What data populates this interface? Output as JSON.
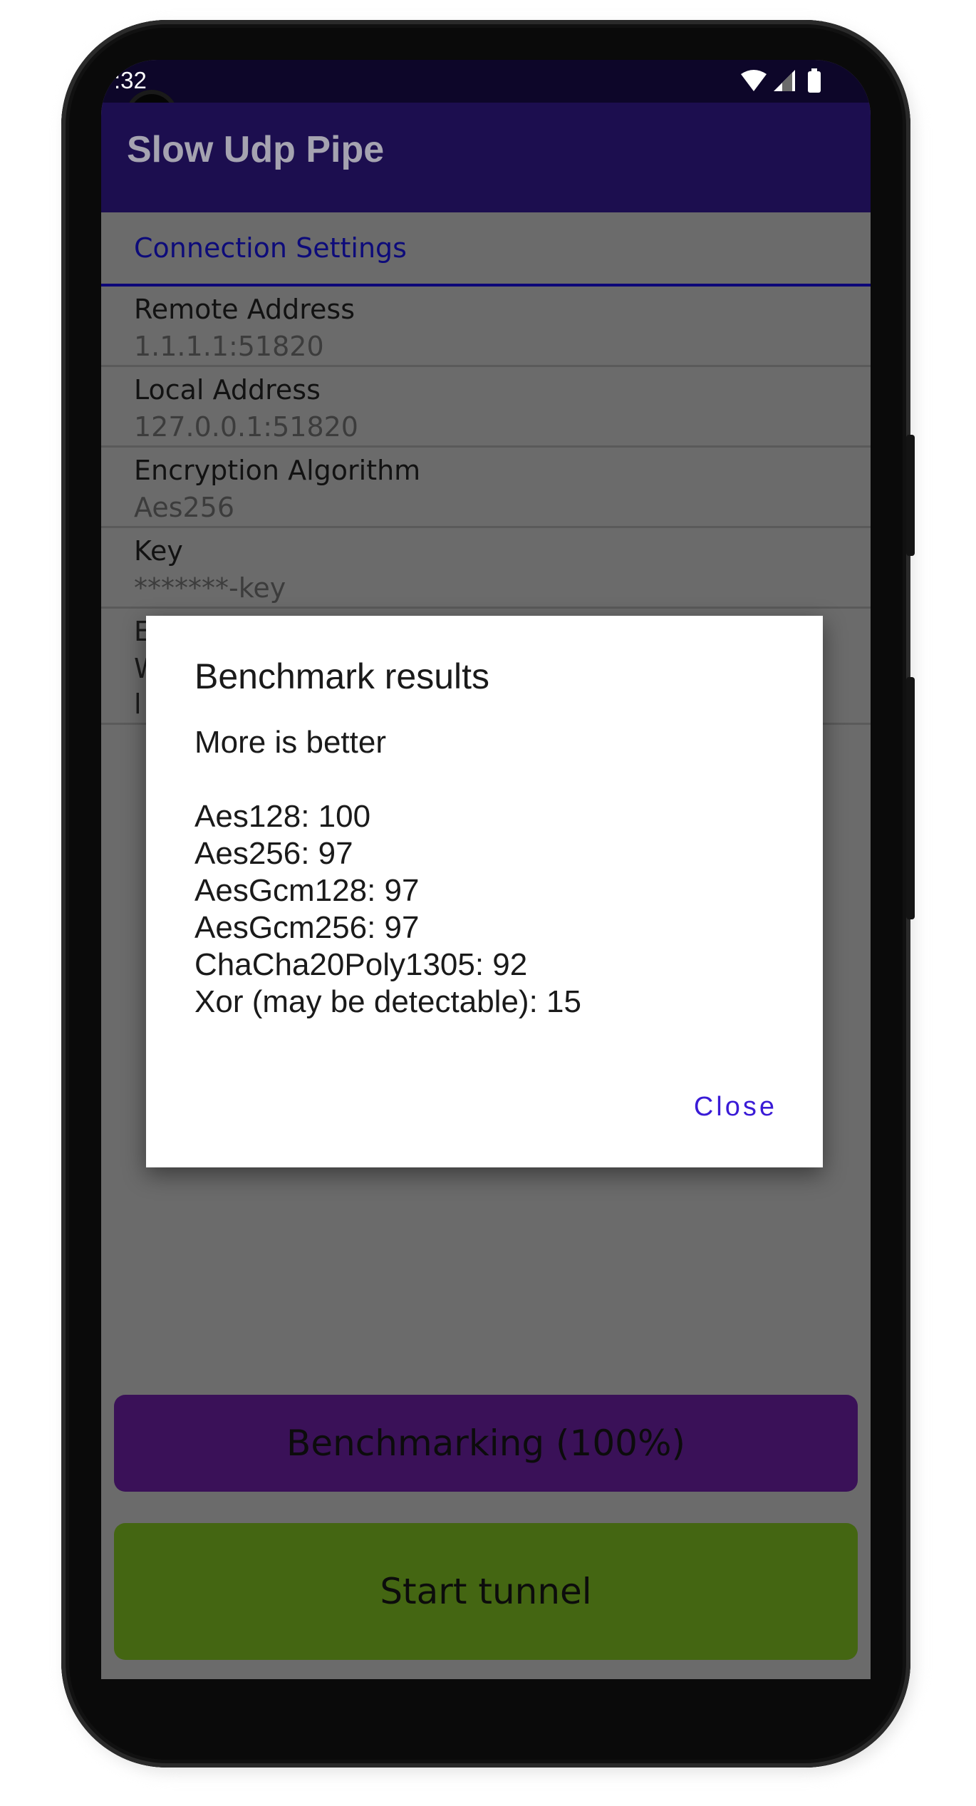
{
  "status_bar": {
    "time": ":32"
  },
  "app_bar": {
    "title": "Slow Udp Pipe"
  },
  "settings": {
    "section_title": "Connection Settings",
    "rows": [
      {
        "label": "Remote Address",
        "value": "1.1.1.1:51820"
      },
      {
        "label": "Local Address",
        "value": "127.0.0.1:51820"
      },
      {
        "label": "Encryption Algorithm",
        "value": "Aes256"
      },
      {
        "label": "Key",
        "value": "*******-key"
      },
      {
        "label": "E",
        "value": "W",
        "value2": "l"
      }
    ]
  },
  "dialog": {
    "title": "Benchmark results",
    "subtitle": "More is better",
    "results": [
      "Aes128: 100",
      "Aes256: 97",
      "AesGcm128: 97",
      "AesGcm256: 97",
      "ChaCha20Poly1305: 92",
      "Xor (may be detectable): 15"
    ],
    "close_label": "Close"
  },
  "buttons": {
    "benchmark_label": "Benchmarking (100%)",
    "start_label": "Start tunnel"
  },
  "colors": {
    "app_bar": "#1c0e4f",
    "accent_text": "#0d0b7a",
    "benchmark_button": "#3a1158",
    "start_button": "#446612",
    "dialog_action": "#3a1bd6"
  },
  "icons": [
    "wifi-icon",
    "cellular-signal-icon",
    "battery-icon",
    "front-camera"
  ]
}
